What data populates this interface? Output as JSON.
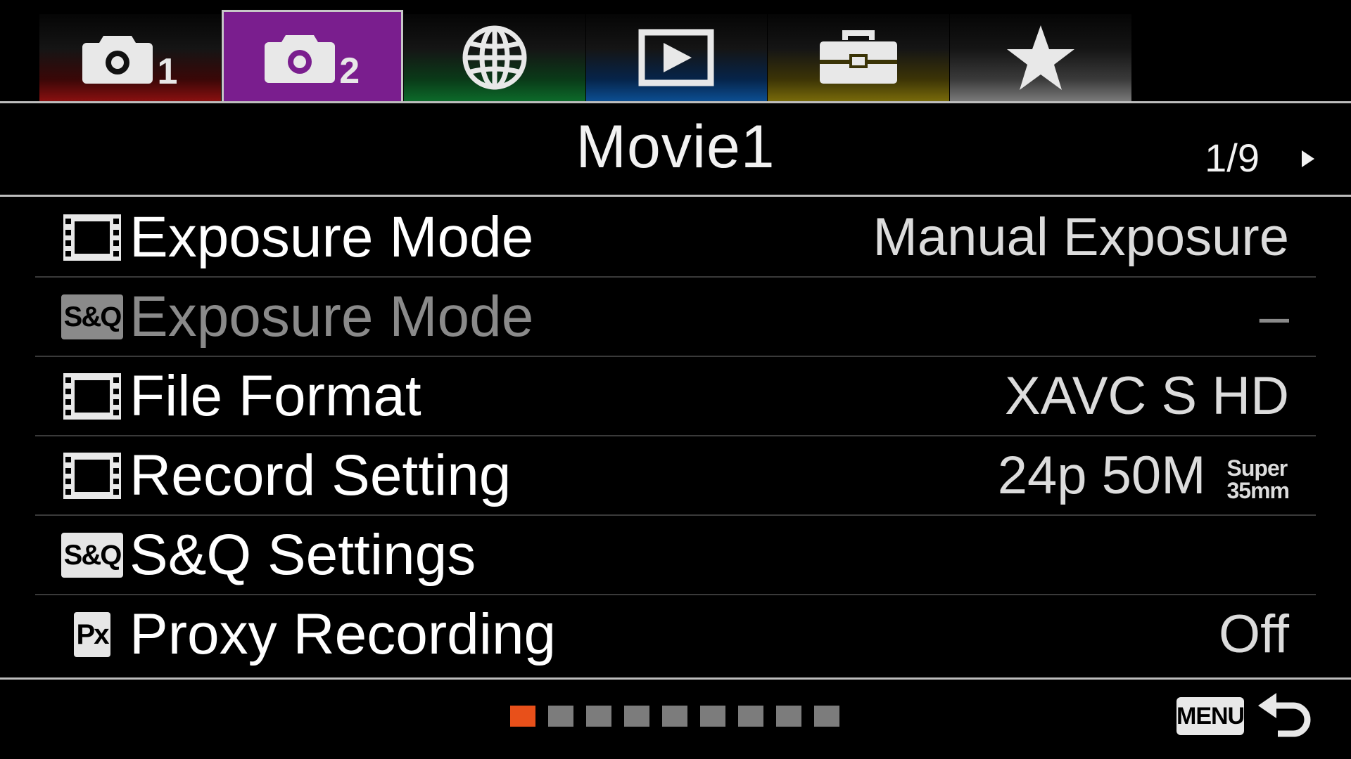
{
  "tabs": [
    {
      "name": "camera-1",
      "icon": "camera-icon",
      "number": "1",
      "active": false
    },
    {
      "name": "camera-2",
      "icon": "camera-icon",
      "number": "2",
      "active": true
    },
    {
      "name": "network",
      "icon": "globe-icon",
      "number": "",
      "active": false
    },
    {
      "name": "playback",
      "icon": "playback-icon",
      "number": "",
      "active": false
    },
    {
      "name": "setup",
      "icon": "toolbox-icon",
      "number": "",
      "active": false
    },
    {
      "name": "my-menu",
      "icon": "star-icon",
      "number": "",
      "active": false
    }
  ],
  "header": {
    "title": "Movie1",
    "page": "1/9"
  },
  "rows": [
    {
      "badge": "film-icon",
      "label": "Exposure Mode",
      "value": "Manual Exposure",
      "enabled": true
    },
    {
      "badge": "sq-icon",
      "badge_text": "S&Q",
      "label": "Exposure Mode",
      "value": "–",
      "enabled": false
    },
    {
      "badge": "film-icon",
      "label": "File Format",
      "value": "XAVC S HD",
      "enabled": true
    },
    {
      "badge": "film-icon",
      "label": "Record Setting",
      "value": "24p 50M",
      "value_extra_top": "Super",
      "value_extra_bottom": "35mm",
      "enabled": true
    },
    {
      "badge": "sq-icon",
      "badge_text": "S&Q",
      "label": "S&Q Settings",
      "value": "",
      "enabled": true
    },
    {
      "badge": "px-icon",
      "badge_text": "Px",
      "label": "Proxy Recording",
      "value": "Off",
      "enabled": true
    }
  ],
  "footer": {
    "page_count": 9,
    "active_page": 1,
    "menu_label": "MENU",
    "back_icon": "back-arrow-icon"
  },
  "colors": {
    "active_tab": "#7a1e8e",
    "active_page_dot": "#e8501a",
    "inactive_page_dot": "#7c7c7c"
  }
}
